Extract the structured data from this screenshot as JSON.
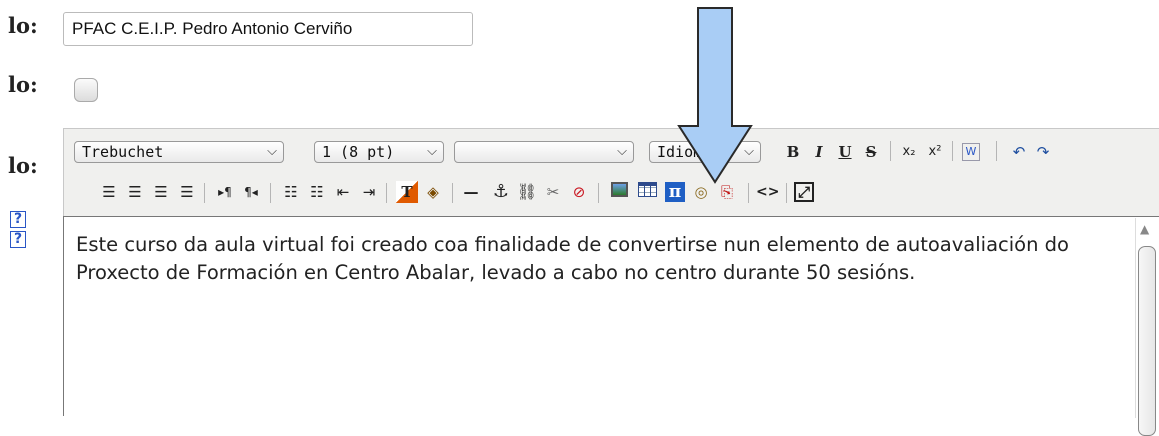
{
  "form": {
    "label_1": "lo:",
    "label_2": "lo:",
    "label_3": "lo:",
    "title_value": "PFAC C.E.I.P. Pedro Antonio Cerviño",
    "help_icon_1": "?",
    "help_icon_2": "?"
  },
  "toolbar": {
    "font_family": "Trebuchet",
    "font_size": "1 (8 pt)",
    "format": "",
    "language": "Idioma",
    "bold": "B",
    "italic": "I",
    "underline": "U",
    "strike": "S",
    "subscript": "x₂",
    "superscript": "x²",
    "word_icon": "W",
    "undo": "↶",
    "redo": "↷",
    "ltr": "▸¶",
    "rtl": "¶◂",
    "hr": "—",
    "anchor": "⚓",
    "link": "⛓",
    "unlink": "✂",
    "nolink": "⊘",
    "pi": "π",
    "code": "<>",
    "fullscreen": "⤢",
    "text_color": "T",
    "bg_color": "◈",
    "object": "◎",
    "paste": "⎘"
  },
  "editor": {
    "content": "Este curso da aula virtual foi creado coa finalidade de convertirse nun elemento de autoavaliación do Proxecto de Formación en Centro Abalar, levado a cabo no centro durante 50 sesións."
  },
  "colors": {
    "annotation_arrow_fill": "#a9cdf5",
    "annotation_arrow_stroke": "#2a2a2a",
    "help_icon": "#2a56c6"
  }
}
